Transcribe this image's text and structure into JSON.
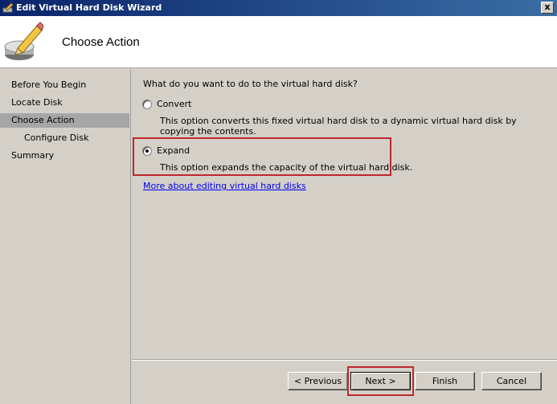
{
  "window": {
    "title": "Edit Virtual Hard Disk Wizard",
    "close_label": "x"
  },
  "header": {
    "title": "Choose Action",
    "icon": "disk-pencil-icon"
  },
  "sidebar": {
    "items": [
      {
        "label": "Before You Begin"
      },
      {
        "label": "Locate Disk"
      },
      {
        "label": "Choose Action"
      },
      {
        "label": "Configure Disk"
      },
      {
        "label": "Summary"
      }
    ],
    "active_index": 2
  },
  "content": {
    "question": "What do you want to do to the virtual hard disk?",
    "options": [
      {
        "label": "Convert",
        "description": "This option converts this fixed virtual hard disk to a dynamic virtual hard disk by copying the contents.",
        "selected": false
      },
      {
        "label": "Expand",
        "description": "This option expands the capacity of the virtual hard disk.",
        "selected": true
      }
    ],
    "link": "More about editing virtual hard disks"
  },
  "buttons": {
    "previous": "< Previous",
    "next": "Next >",
    "finish": "Finish",
    "cancel": "Cancel"
  },
  "colors": {
    "highlight": "#c0272d",
    "titlebar": "#0a246a"
  }
}
